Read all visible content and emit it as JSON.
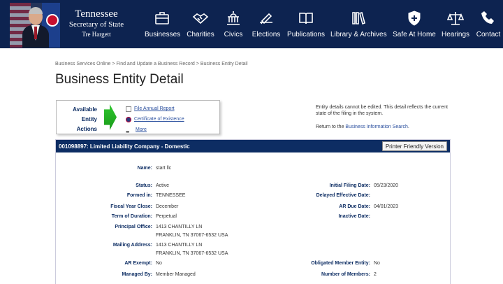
{
  "header": {
    "brand_line1": "Tennessee",
    "brand_line2": "Secretary of State",
    "brand_line3": "Tre Hargett",
    "nav": [
      {
        "label": "Businesses",
        "icon": "briefcase-icon"
      },
      {
        "label": "Charities",
        "icon": "handshake-icon"
      },
      {
        "label": "Civics",
        "icon": "capitol-icon"
      },
      {
        "label": "Elections",
        "icon": "ballot-icon"
      },
      {
        "label": "Publications",
        "icon": "book-icon"
      },
      {
        "label": "Library & Archives",
        "icon": "library-icon"
      },
      {
        "label": "Safe At Home",
        "icon": "shield-icon"
      },
      {
        "label": "Hearings",
        "icon": "scales-icon"
      },
      {
        "label": "Contact",
        "icon": "phone-icon"
      }
    ]
  },
  "breadcrumb": {
    "items": [
      "Business Services Online",
      "Find and Update a Business Record",
      "Business Entity Detail"
    ],
    "sep": ">"
  },
  "page_title": "Business Entity Detail",
  "actions": {
    "caption_line1": "Available",
    "caption_line2": "Entity",
    "caption_line3": "Actions",
    "links": [
      "File Annual Report",
      "Certificate of Existence",
      "More"
    ]
  },
  "info": {
    "note": "Entity details cannot be edited. This detail reflects the current state of the filing in the system.",
    "return_prefix": "Return to the",
    "return_link": "Business Information Search"
  },
  "entity": {
    "heading": "001098897: Limited Liability Company - Domestic",
    "print_label": "Printer Friendly Version",
    "fields_left": [
      {
        "label": "Name:",
        "value": "start llc"
      },
      {
        "label": "Status:",
        "value": "Active"
      },
      {
        "label": "Formed in:",
        "value": "TENNESSEE"
      },
      {
        "label": "Fiscal Year Close:",
        "value": "December"
      },
      {
        "label": "Term of Duration:",
        "value": "Perpetual"
      },
      {
        "label": "Principal Office:",
        "value": "1413 CHANTILLY LN",
        "value2": "FRANKLIN, TN 37067-6532 USA"
      },
      {
        "label": "Mailing Address:",
        "value": "1413 CHANTILLY LN",
        "value2": "FRANKLIN, TN 37067-6532 USA"
      },
      {
        "label": "AR Exempt:",
        "value": "No"
      },
      {
        "label": "Managed By:",
        "value": "Member Managed"
      }
    ],
    "fields_right": [
      {
        "label": "Initial Filing Date:",
        "value": "05/23/2020"
      },
      {
        "label": "Delayed Effective Date:",
        "value": ""
      },
      {
        "label": "AR Due Date:",
        "value": "04/01/2023"
      },
      {
        "label": "Inactive Date:",
        "value": ""
      },
      {
        "label": "Obligated Member Entity:",
        "value": "No"
      },
      {
        "label": "Number of Members:",
        "value": "2"
      }
    ]
  }
}
